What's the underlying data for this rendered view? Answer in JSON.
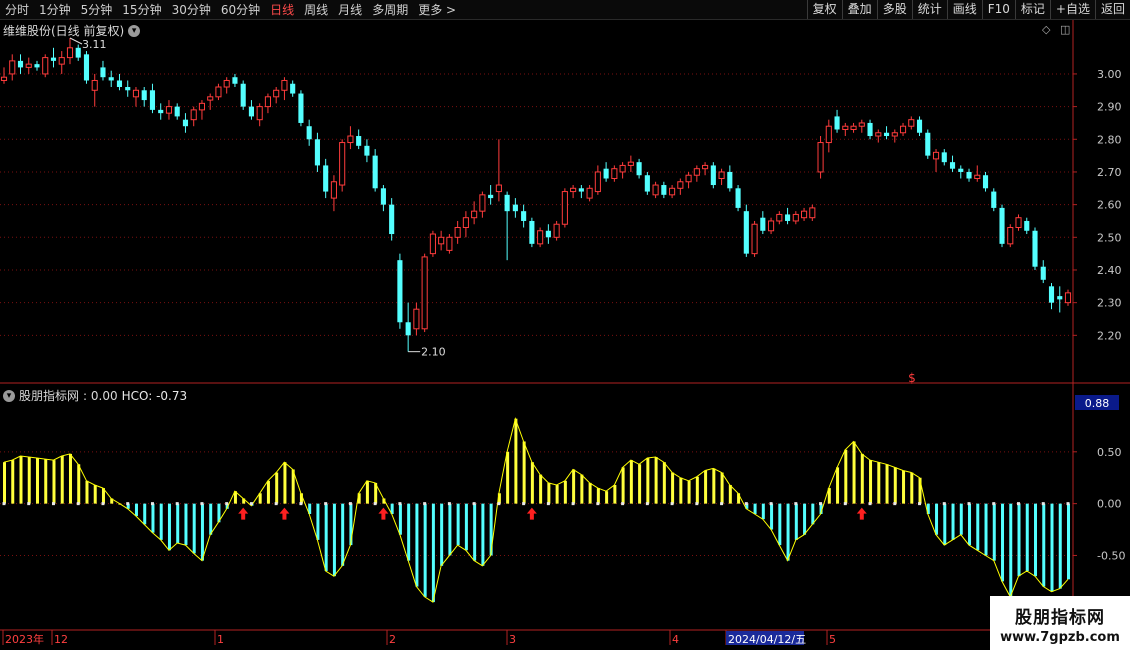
{
  "toolbar": {
    "timeframes": [
      "分时",
      "1分钟",
      "5分钟",
      "15分钟",
      "30分钟",
      "60分钟",
      "日线",
      "周线",
      "月线",
      "多周期",
      "更多 >"
    ],
    "active_index": 6,
    "right_buttons": [
      "复权",
      "叠加",
      "多股",
      "统计",
      "画线",
      "F10",
      "标记",
      "+自选",
      "返回"
    ]
  },
  "main_chart": {
    "title": "维维股份(日线 前复权)",
    "y_ticks": [
      "3.00",
      "2.90",
      "2.80",
      "2.70",
      "2.60",
      "2.50",
      "2.40",
      "2.30",
      "2.20"
    ],
    "high_label": "3.11",
    "low_label": "2.10",
    "marker": "$",
    "colors": {
      "up": "#ff3c3c",
      "down": "#54ffff",
      "axis": "#b22222"
    }
  },
  "indicator": {
    "name": "股朋指标网",
    "value_text": ": 0.00",
    "hco_text": "HCO: -0.73",
    "current_badge": "0.88",
    "y_ticks": [
      "0.50",
      "0.00",
      "-0.50"
    ],
    "colors": {
      "pos": "#ffff3c",
      "neg": "#54ffff",
      "line": "#ffff00",
      "arrow": "#ff2020"
    }
  },
  "date_axis": {
    "labels": [
      "2023年",
      "12",
      "1",
      "2",
      "3",
      "4",
      "2024/04/12/五",
      "5"
    ]
  },
  "watermark": {
    "line1": "股朋指标网",
    "line2": "www.7gpzb.com"
  },
  "chart_data": {
    "type": "candlestick",
    "ylim": [
      2.1,
      3.11
    ],
    "candles_ohlc": [
      [
        2.98,
        3.02,
        2.97,
        2.99
      ],
      [
        3.0,
        3.06,
        2.98,
        3.04
      ],
      [
        3.04,
        3.06,
        3.0,
        3.02
      ],
      [
        3.02,
        3.05,
        3.0,
        3.03
      ],
      [
        3.03,
        3.04,
        3.01,
        3.02
      ],
      [
        3.0,
        3.06,
        2.99,
        3.05
      ],
      [
        3.05,
        3.08,
        3.02,
        3.04
      ],
      [
        3.03,
        3.07,
        3.0,
        3.05
      ],
      [
        3.05,
        3.11,
        3.03,
        3.08
      ],
      [
        3.08,
        3.09,
        3.04,
        3.05
      ],
      [
        3.06,
        3.07,
        2.97,
        2.98
      ],
      [
        2.95,
        3.0,
        2.9,
        2.98
      ],
      [
        3.02,
        3.04,
        2.98,
        2.99
      ],
      [
        2.99,
        3.01,
        2.96,
        2.98
      ],
      [
        2.98,
        3.0,
        2.95,
        2.96
      ],
      [
        2.96,
        2.98,
        2.93,
        2.95
      ],
      [
        2.93,
        2.96,
        2.9,
        2.95
      ],
      [
        2.95,
        2.96,
        2.9,
        2.92
      ],
      [
        2.95,
        2.97,
        2.88,
        2.89
      ],
      [
        2.89,
        2.91,
        2.86,
        2.88
      ],
      [
        2.88,
        2.92,
        2.86,
        2.9
      ],
      [
        2.9,
        2.91,
        2.86,
        2.87
      ],
      [
        2.86,
        2.88,
        2.82,
        2.84
      ],
      [
        2.86,
        2.9,
        2.84,
        2.89
      ],
      [
        2.89,
        2.92,
        2.86,
        2.91
      ],
      [
        2.92,
        2.94,
        2.89,
        2.93
      ],
      [
        2.93,
        2.97,
        2.92,
        2.96
      ],
      [
        2.96,
        2.99,
        2.94,
        2.98
      ],
      [
        2.99,
        3.0,
        2.96,
        2.97
      ],
      [
        2.97,
        2.98,
        2.89,
        2.9
      ],
      [
        2.9,
        2.92,
        2.86,
        2.87
      ],
      [
        2.86,
        2.91,
        2.84,
        2.9
      ],
      [
        2.9,
        2.94,
        2.88,
        2.93
      ],
      [
        2.93,
        2.96,
        2.91,
        2.95
      ],
      [
        2.95,
        2.99,
        2.92,
        2.98
      ],
      [
        2.97,
        2.98,
        2.93,
        2.94
      ],
      [
        2.94,
        2.95,
        2.84,
        2.85
      ],
      [
        2.84,
        2.86,
        2.78,
        2.8
      ],
      [
        2.8,
        2.82,
        2.7,
        2.72
      ],
      [
        2.72,
        2.74,
        2.62,
        2.64
      ],
      [
        2.62,
        2.69,
        2.58,
        2.67
      ],
      [
        2.66,
        2.8,
        2.64,
        2.79
      ],
      [
        2.79,
        2.84,
        2.77,
        2.81
      ],
      [
        2.81,
        2.83,
        2.77,
        2.78
      ],
      [
        2.78,
        2.8,
        2.73,
        2.75
      ],
      [
        2.75,
        2.77,
        2.64,
        2.65
      ],
      [
        2.65,
        2.66,
        2.58,
        2.6
      ],
      [
        2.6,
        2.62,
        2.49,
        2.51
      ],
      [
        2.43,
        2.45,
        2.22,
        2.24
      ],
      [
        2.24,
        2.3,
        2.15,
        2.2
      ],
      [
        2.22,
        2.3,
        2.2,
        2.28
      ],
      [
        2.22,
        2.45,
        2.21,
        2.44
      ],
      [
        2.45,
        2.52,
        2.44,
        2.51
      ],
      [
        2.48,
        2.52,
        2.46,
        2.5
      ],
      [
        2.46,
        2.51,
        2.45,
        2.5
      ],
      [
        2.5,
        2.55,
        2.48,
        2.53
      ],
      [
        2.53,
        2.58,
        2.5,
        2.56
      ],
      [
        2.56,
        2.61,
        2.54,
        2.58
      ],
      [
        2.58,
        2.64,
        2.56,
        2.63
      ],
      [
        2.63,
        2.66,
        2.6,
        2.62
      ],
      [
        2.64,
        2.8,
        2.61,
        2.66
      ],
      [
        2.63,
        2.64,
        2.43,
        2.58
      ],
      [
        2.6,
        2.62,
        2.56,
        2.58
      ],
      [
        2.58,
        2.6,
        2.53,
        2.55
      ],
      [
        2.55,
        2.56,
        2.47,
        2.48
      ],
      [
        2.48,
        2.53,
        2.47,
        2.52
      ],
      [
        2.52,
        2.54,
        2.48,
        2.5
      ],
      [
        2.5,
        2.55,
        2.49,
        2.54
      ],
      [
        2.54,
        2.65,
        2.53,
        2.64
      ],
      [
        2.64,
        2.66,
        2.62,
        2.65
      ],
      [
        2.65,
        2.66,
        2.62,
        2.64
      ],
      [
        2.62,
        2.66,
        2.61,
        2.65
      ],
      [
        2.64,
        2.72,
        2.63,
        2.7
      ],
      [
        2.71,
        2.73,
        2.67,
        2.68
      ],
      [
        2.68,
        2.72,
        2.67,
        2.71
      ],
      [
        2.7,
        2.73,
        2.68,
        2.72
      ],
      [
        2.72,
        2.75,
        2.7,
        2.73
      ],
      [
        2.73,
        2.74,
        2.68,
        2.69
      ],
      [
        2.69,
        2.7,
        2.63,
        2.64
      ],
      [
        2.63,
        2.67,
        2.62,
        2.66
      ],
      [
        2.66,
        2.67,
        2.62,
        2.63
      ],
      [
        2.63,
        2.66,
        2.62,
        2.65
      ],
      [
        2.65,
        2.68,
        2.63,
        2.67
      ],
      [
        2.67,
        2.7,
        2.65,
        2.69
      ],
      [
        2.69,
        2.72,
        2.67,
        2.71
      ],
      [
        2.71,
        2.73,
        2.69,
        2.72
      ],
      [
        2.72,
        2.73,
        2.65,
        2.66
      ],
      [
        2.68,
        2.71,
        2.66,
        2.7
      ],
      [
        2.7,
        2.72,
        2.64,
        2.65
      ],
      [
        2.65,
        2.66,
        2.58,
        2.59
      ],
      [
        2.58,
        2.6,
        2.44,
        2.45
      ],
      [
        2.45,
        2.55,
        2.44,
        2.54
      ],
      [
        2.56,
        2.58,
        2.51,
        2.52
      ],
      [
        2.52,
        2.56,
        2.51,
        2.55
      ],
      [
        2.55,
        2.58,
        2.54,
        2.57
      ],
      [
        2.57,
        2.59,
        2.54,
        2.55
      ],
      [
        2.55,
        2.58,
        2.54,
        2.57
      ],
      [
        2.56,
        2.59,
        2.55,
        2.58
      ],
      [
        2.56,
        2.6,
        2.55,
        2.59
      ],
      [
        2.7,
        2.81,
        2.68,
        2.79
      ],
      [
        2.79,
        2.86,
        2.76,
        2.84
      ],
      [
        2.87,
        2.89,
        2.82,
        2.83
      ],
      [
        2.83,
        2.85,
        2.81,
        2.84
      ],
      [
        2.83,
        2.85,
        2.82,
        2.84
      ],
      [
        2.84,
        2.86,
        2.82,
        2.85
      ],
      [
        2.85,
        2.86,
        2.8,
        2.81
      ],
      [
        2.81,
        2.83,
        2.79,
        2.82
      ],
      [
        2.82,
        2.84,
        2.8,
        2.81
      ],
      [
        2.81,
        2.83,
        2.79,
        2.82
      ],
      [
        2.82,
        2.85,
        2.81,
        2.84
      ],
      [
        2.84,
        2.87,
        2.83,
        2.86
      ],
      [
        2.86,
        2.87,
        2.81,
        2.82
      ],
      [
        2.82,
        2.83,
        2.74,
        2.75
      ],
      [
        2.74,
        2.77,
        2.7,
        2.76
      ],
      [
        2.76,
        2.77,
        2.72,
        2.73
      ],
      [
        2.73,
        2.75,
        2.7,
        2.71
      ],
      [
        2.71,
        2.72,
        2.68,
        2.7
      ],
      [
        2.7,
        2.71,
        2.67,
        2.68
      ],
      [
        2.68,
        2.72,
        2.67,
        2.69
      ],
      [
        2.69,
        2.7,
        2.64,
        2.65
      ],
      [
        2.64,
        2.65,
        2.58,
        2.59
      ],
      [
        2.59,
        2.6,
        2.47,
        2.48
      ],
      [
        2.48,
        2.54,
        2.47,
        2.53
      ],
      [
        2.53,
        2.57,
        2.52,
        2.56
      ],
      [
        2.55,
        2.56,
        2.51,
        2.52
      ],
      [
        2.52,
        2.53,
        2.4,
        2.41
      ],
      [
        2.41,
        2.43,
        2.36,
        2.37
      ],
      [
        2.35,
        2.36,
        2.28,
        2.3
      ],
      [
        2.32,
        2.35,
        2.27,
        2.31
      ],
      [
        2.3,
        2.34,
        2.29,
        2.33
      ]
    ],
    "hco_values": [
      0.4,
      0.42,
      0.46,
      0.45,
      0.44,
      0.43,
      0.42,
      0.46,
      0.48,
      0.38,
      0.22,
      0.18,
      0.15,
      0.05,
      0.0,
      -0.05,
      -0.12,
      -0.2,
      -0.28,
      -0.35,
      -0.45,
      -0.38,
      -0.4,
      -0.48,
      -0.55,
      -0.3,
      -0.18,
      -0.05,
      0.12,
      0.05,
      -0.02,
      0.1,
      0.22,
      0.3,
      0.4,
      0.33,
      0.1,
      -0.1,
      -0.35,
      -0.65,
      -0.7,
      -0.6,
      -0.4,
      0.1,
      0.22,
      0.2,
      0.05,
      -0.1,
      -0.3,
      -0.55,
      -0.8,
      -0.9,
      -0.95,
      -0.6,
      -0.5,
      -0.4,
      -0.45,
      -0.55,
      -0.6,
      -0.5,
      0.1,
      0.5,
      0.82,
      0.6,
      0.4,
      0.28,
      0.2,
      0.18,
      0.22,
      0.33,
      0.28,
      0.2,
      0.15,
      0.12,
      0.18,
      0.35,
      0.42,
      0.38,
      0.44,
      0.45,
      0.4,
      0.3,
      0.25,
      0.22,
      0.26,
      0.32,
      0.34,
      0.3,
      0.18,
      0.1,
      -0.05,
      -0.1,
      -0.15,
      -0.25,
      -0.4,
      -0.55,
      -0.35,
      -0.3,
      -0.2,
      -0.1,
      0.15,
      0.35,
      0.52,
      0.6,
      0.48,
      0.42,
      0.4,
      0.38,
      0.35,
      0.32,
      0.3,
      0.25,
      -0.1,
      -0.3,
      -0.4,
      -0.35,
      -0.3,
      -0.4,
      -0.45,
      -0.5,
      -0.55,
      -0.75,
      -0.9,
      -0.7,
      -0.65,
      -0.7,
      -0.8,
      -0.85,
      -0.82,
      -0.73
    ],
    "signal_arrow_indices": [
      29,
      34,
      46,
      64,
      104
    ],
    "indicator_ylim": [
      -1.2,
      1.0
    ]
  }
}
